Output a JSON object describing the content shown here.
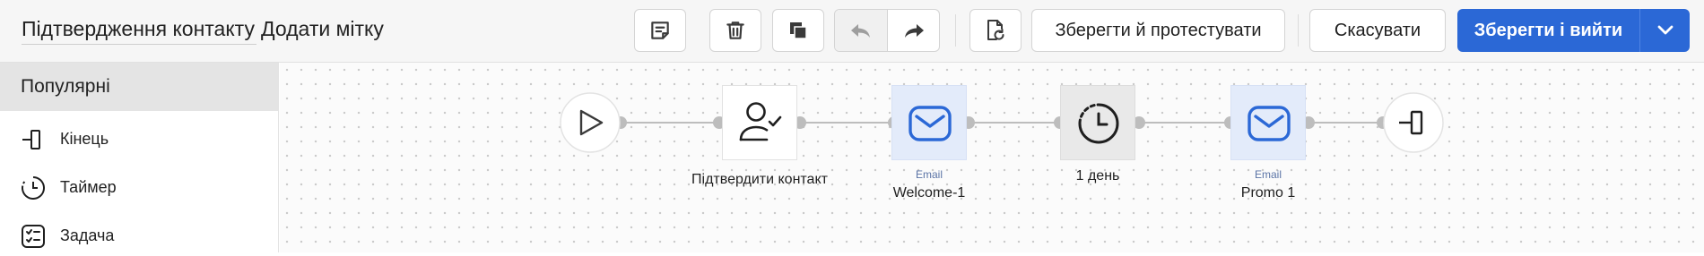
{
  "toolbar": {
    "flow_name": "Підтвердження контакту",
    "add_tag": "Додати мітку",
    "notes_icon": "note-icon",
    "delete_icon": "trash-icon",
    "duplicate_icon": "copy-icon",
    "undo_icon": "undo-icon",
    "redo_icon": "redo-icon",
    "history_icon": "document-history-icon",
    "save_test_label": "Зберегти й протестувати",
    "cancel_label": "Скасувати",
    "save_exit_label": "Зберегти і вийти",
    "dropdown_icon": "chevron-down-icon",
    "primary_color": "#2b68d6"
  },
  "sidebar": {
    "section_title": "Популярні",
    "items": [
      {
        "label": "Кінець",
        "icon": "end-icon"
      },
      {
        "label": "Таймер",
        "icon": "timer-icon"
      },
      {
        "label": "Задача",
        "icon": "task-icon"
      }
    ]
  },
  "flow": {
    "nodes": [
      {
        "type": "start",
        "icon": "play-icon"
      },
      {
        "type": "action",
        "icon": "user-check-icon",
        "label": "Підтвердити контакт"
      },
      {
        "type": "email",
        "icon": "email-icon",
        "type_label": "Email",
        "label": "Welcome-1"
      },
      {
        "type": "timer",
        "icon": "clock-icon",
        "label": "1 день"
      },
      {
        "type": "email",
        "icon": "email-icon",
        "type_label": "Email",
        "label": "Promo 1"
      },
      {
        "type": "end",
        "icon": "end-icon"
      }
    ]
  }
}
